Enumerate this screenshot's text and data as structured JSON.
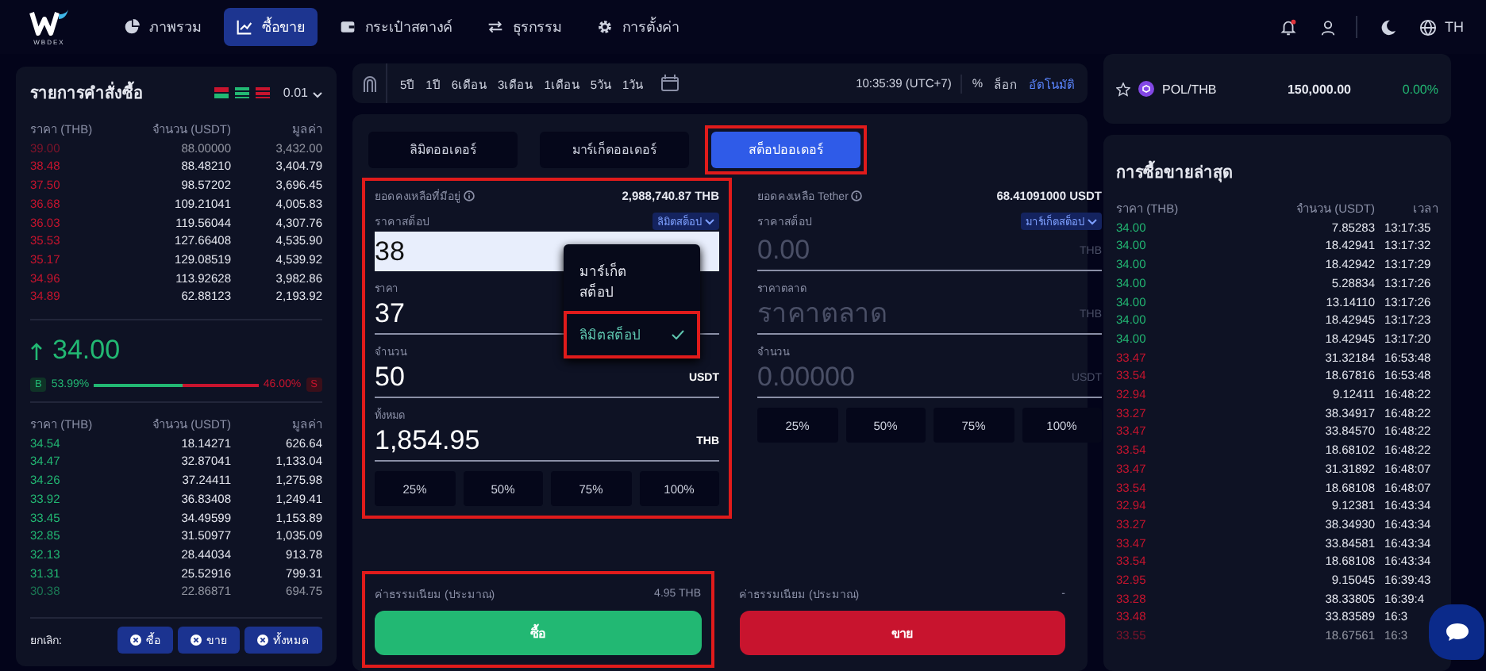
{
  "nav": {
    "brand": "WBDEX",
    "items": [
      {
        "label": "ภาพรวม",
        "kind": "pie",
        "selected": false
      },
      {
        "label": "ซื้อขาย",
        "kind": "chart",
        "selected": true
      },
      {
        "label": "กระเป๋าสตางค์",
        "kind": "wallet",
        "selected": false
      },
      {
        "label": "ธุรกรรม",
        "kind": "swap",
        "selected": false
      },
      {
        "label": "การตั้งค่า",
        "kind": "gear",
        "selected": false
      }
    ],
    "notification": true,
    "language": "TH"
  },
  "order_book": {
    "title": "รายการคำสั่งซื้อ",
    "precision": "0.01",
    "columns": [
      "ราคา (THB)",
      "จำนวน (USDT)",
      "มูลค่า"
    ],
    "asks": [
      {
        "price": "39.00",
        "amount": "88.00000",
        "total": "3,432.00",
        "faded": true
      },
      {
        "price": "38.48",
        "amount": "88.48210",
        "total": "3,404.79",
        "faded": false
      },
      {
        "price": "37.50",
        "amount": "98.57202",
        "total": "3,696.45",
        "faded": false
      },
      {
        "price": "36.68",
        "amount": "109.21041",
        "total": "4,005.83",
        "faded": false
      },
      {
        "price": "36.03",
        "amount": "119.56044",
        "total": "4,307.76",
        "faded": false
      },
      {
        "price": "35.53",
        "amount": "127.66408",
        "total": "4,535.90",
        "faded": false
      },
      {
        "price": "35.17",
        "amount": "129.08519",
        "total": "4,539.92",
        "faded": false
      },
      {
        "price": "34.96",
        "amount": "113.92628",
        "total": "3,982.86",
        "faded": false
      },
      {
        "price": "34.89",
        "amount": "62.88123",
        "total": "2,193.92",
        "faded": false
      }
    ],
    "last_price": "34.00",
    "buy_label": "B",
    "buy_pct": "53.99%",
    "level": 0.54,
    "sell_pct": "46.00%",
    "sell_label": "S",
    "bid_columns": [
      "ราคา (THB)",
      "จำนวน (USDT)",
      "มูลค่า"
    ],
    "bids": [
      {
        "price": "34.54",
        "amount": "18.14271",
        "total": "626.64",
        "faded": false
      },
      {
        "price": "34.47",
        "amount": "32.87041",
        "total": "1,133.04",
        "faded": false
      },
      {
        "price": "34.26",
        "amount": "37.24411",
        "total": "1,275.98",
        "faded": false
      },
      {
        "price": "33.92",
        "amount": "36.83408",
        "total": "1,249.41",
        "faded": false
      },
      {
        "price": "33.45",
        "amount": "34.49599",
        "total": "1,153.89",
        "faded": false
      },
      {
        "price": "32.85",
        "amount": "31.50977",
        "total": "1,035.09",
        "faded": false
      },
      {
        "price": "32.13",
        "amount": "28.44034",
        "total": "913.78",
        "faded": false
      },
      {
        "price": "31.31",
        "amount": "25.52916",
        "total": "799.31",
        "faded": false
      },
      {
        "price": "30.38",
        "amount": "22.86871",
        "total": "694.75",
        "faded": true
      }
    ],
    "cancel_label": "ยกเลิก:",
    "cancel_buttons": [
      "ซื้อ",
      "ขาย",
      "ทั้งหมด"
    ]
  },
  "chart_toolbar": {
    "ranges": [
      "5ปี",
      "1ปี",
      "6เดือน",
      "3เดือน",
      "1เดือน",
      "5วัน",
      "1วัน"
    ],
    "time": "10:35:39 (UTC+7)",
    "percent": "%",
    "log": "ล็อก",
    "auto": "อัตโนมัติ"
  },
  "order_tabs": [
    {
      "label": "ลิมิตออเดอร์",
      "selected": false,
      "highlighted": false
    },
    {
      "label": "มาร์เก็ตออเดอร์",
      "selected": false,
      "highlighted": false
    },
    {
      "label": "สต็อปออเดอร์",
      "selected": true,
      "highlighted": true
    }
  ],
  "buy": {
    "form_highlighted": true,
    "footer_highlighted": true,
    "balance_label": "ยอดคงเหลือที่มีอยู่",
    "balance": "2,988,740.87 THB",
    "stop_label": "ราคาสต็อป",
    "type": "ลิมิตสต็อป",
    "stop_value": "38",
    "price_label": "ราคา",
    "price_value": "37",
    "amount_label": "จำนวน",
    "amount_value": "50",
    "amount_unit": "USDT",
    "total_label": "ทั้งหมด",
    "total_value": "1,854.95",
    "total_unit": "THB",
    "percents": [
      "25%",
      "50%",
      "75%",
      "100%"
    ],
    "fee_label": "ค่าธรรมเนียม (ประมาณ)",
    "fee": "4.95 THB",
    "button": "ซื้อ"
  },
  "type_menu": [
    {
      "label": "มาร์เก็ตสต็อป",
      "selected": false,
      "highlighted": false
    },
    {
      "label": "ลิมิตสต็อป",
      "selected": true,
      "highlighted": true
    }
  ],
  "sell": {
    "form_highlighted": false,
    "footer_highlighted": false,
    "balance_label": "ยอดคงเหลือ Tether",
    "balance": "68.41091000 USDT",
    "stop_label": "ราคาสต็อป",
    "type": "มาร์เก็ตสต็อป",
    "stop_placeholder": "0.00",
    "stop_unit": "THB",
    "price_label": "ราคาตลาด",
    "price_placeholder": "ราคาตลาด",
    "price_unit": "THB",
    "amount_label": "จำนวน",
    "amount_placeholder": "0.00000",
    "amount_unit": "USDT",
    "percents": [
      "25%",
      "50%",
      "75%",
      "100%"
    ],
    "fee_label": "ค่าธรรมเนียม (ประมาณ)",
    "fee": "-",
    "button": "ขาย"
  },
  "market": {
    "pair": "POL/THB",
    "price": "150,000.00",
    "change": "0.00%"
  },
  "trades": {
    "title": "การซื้อขายล่าสุด",
    "columns": [
      "ราคา (THB)",
      "จำนวน (USDT)",
      "เวลา"
    ],
    "rows": [
      {
        "price": "34.00",
        "amount": "7.85283",
        "time": "13:17:35",
        "kind": "buy",
        "faded": false
      },
      {
        "price": "34.00",
        "amount": "18.42941",
        "time": "13:17:32",
        "kind": "buy",
        "faded": false
      },
      {
        "price": "34.00",
        "amount": "18.42942",
        "time": "13:17:29",
        "kind": "buy",
        "faded": false
      },
      {
        "price": "34.00",
        "amount": "5.28834",
        "time": "13:17:26",
        "kind": "buy",
        "faded": false
      },
      {
        "price": "34.00",
        "amount": "13.14110",
        "time": "13:17:26",
        "kind": "buy",
        "faded": false
      },
      {
        "price": "34.00",
        "amount": "18.42945",
        "time": "13:17:23",
        "kind": "buy",
        "faded": false
      },
      {
        "price": "34.00",
        "amount": "18.42945",
        "time": "13:17:20",
        "kind": "buy",
        "faded": false
      },
      {
        "price": "33.47",
        "amount": "31.32184",
        "time": "16:53:48",
        "kind": "sell",
        "faded": false
      },
      {
        "price": "33.54",
        "amount": "18.67816",
        "time": "16:53:48",
        "kind": "sell",
        "faded": false
      },
      {
        "price": "32.94",
        "amount": "9.12411",
        "time": "16:48:22",
        "kind": "sell",
        "faded": false
      },
      {
        "price": "33.27",
        "amount": "38.34917",
        "time": "16:48:22",
        "kind": "sell",
        "faded": false
      },
      {
        "price": "33.47",
        "amount": "33.84570",
        "time": "16:48:22",
        "kind": "sell",
        "faded": false
      },
      {
        "price": "33.54",
        "amount": "18.68102",
        "time": "16:48:22",
        "kind": "sell",
        "faded": false
      },
      {
        "price": "33.47",
        "amount": "31.31892",
        "time": "16:48:07",
        "kind": "sell",
        "faded": false
      },
      {
        "price": "33.54",
        "amount": "18.68108",
        "time": "16:48:07",
        "kind": "sell",
        "faded": false
      },
      {
        "price": "32.94",
        "amount": "9.12381",
        "time": "16:43:34",
        "kind": "sell",
        "faded": false
      },
      {
        "price": "33.27",
        "amount": "38.34930",
        "time": "16:43:34",
        "kind": "sell",
        "faded": false
      },
      {
        "price": "33.47",
        "amount": "33.84581",
        "time": "16:43:34",
        "kind": "sell",
        "faded": false
      },
      {
        "price": "33.54",
        "amount": "18.68108",
        "time": "16:43:34",
        "kind": "sell",
        "faded": false
      },
      {
        "price": "32.95",
        "amount": "9.15045",
        "time": "16:39:43",
        "kind": "sell",
        "faded": false
      },
      {
        "price": "33.28",
        "amount": "38.33805",
        "time": "16:39:4",
        "kind": "sell",
        "faded": false
      },
      {
        "price": "33.48",
        "amount": "33.83589",
        "time": "16:3",
        "kind": "sell",
        "faded": false
      },
      {
        "price": "33.55",
        "amount": "18.67561",
        "time": "16:3",
        "kind": "sell",
        "faded": true
      }
    ]
  }
}
